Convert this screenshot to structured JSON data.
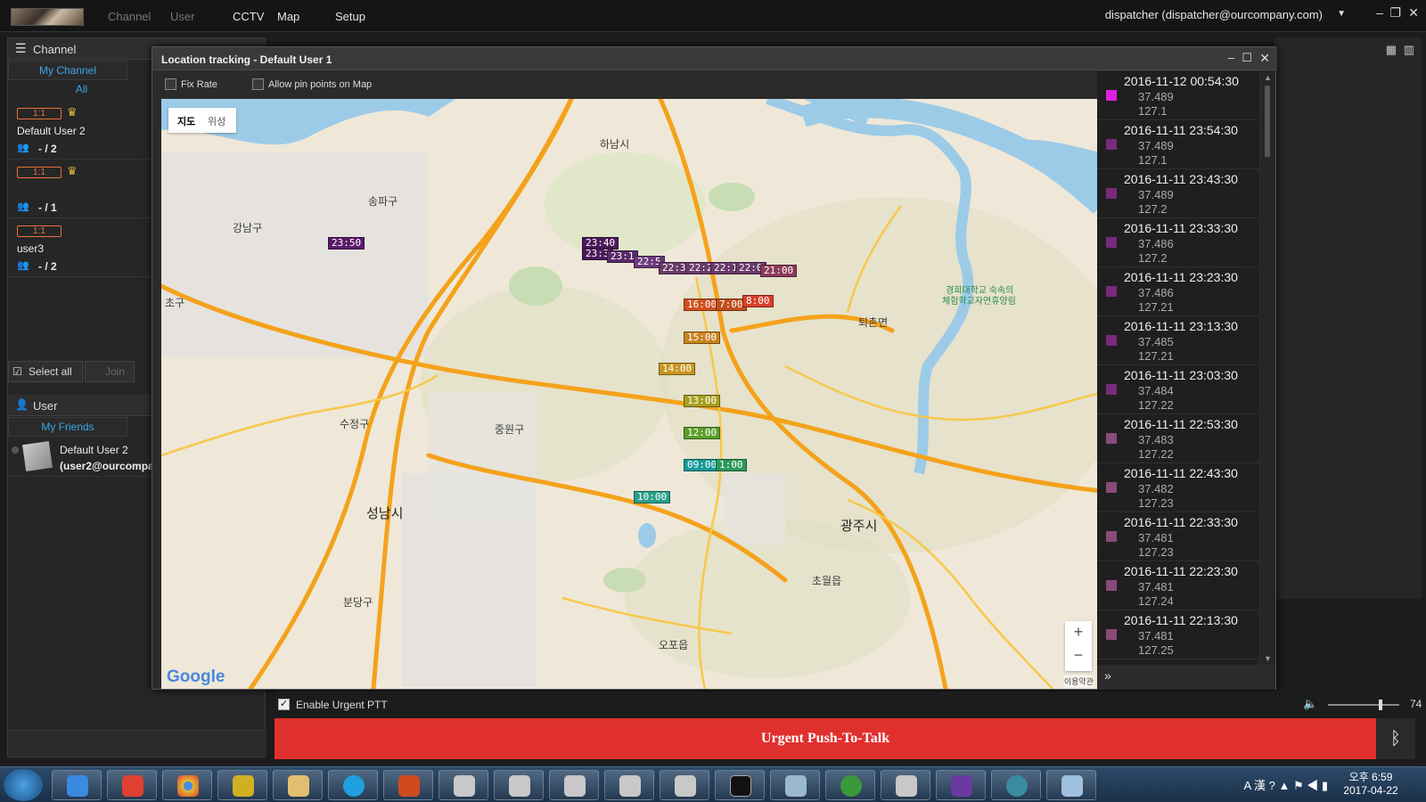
{
  "topbar": {
    "menus": [
      "Channel",
      "User",
      "CCTV",
      "Map",
      "Setup"
    ],
    "user": "dispatcher (dispatcher@ourcompany.com)"
  },
  "left": {
    "channel_header": "Channel",
    "my_channel": "My Channel",
    "all": "All",
    "channels": [
      {
        "badge": "1:1",
        "name": "Default User 2",
        "count": "- / 2"
      },
      {
        "badge": "1:1",
        "name": "",
        "count": "- / 1"
      },
      {
        "badge": "1:1",
        "name": "user3",
        "count": "- / 2"
      }
    ],
    "select_all": "Select all",
    "join": "Join",
    "user_header": "User",
    "my_friends": "My Friends",
    "friend": {
      "name": "Default User 2",
      "email": "(user2@ourcompa"
    }
  },
  "dialog": {
    "title": "Location tracking - Default User 1",
    "fix_rate": "Fix Rate",
    "allow_pin": "Allow pin points on Map",
    "map_tab_map": "지도",
    "map_tab_sat": "위성",
    "zoom_in": "+",
    "zoom_out": "−",
    "google": "Google",
    "terms": "이용약관"
  },
  "map_labels": [
    {
      "t": "하남시"
    },
    {
      "t": "송파구"
    },
    {
      "t": "강남구"
    },
    {
      "t": "초구"
    },
    {
      "t": "수정구"
    },
    {
      "t": "중원구"
    },
    {
      "t": "성남시"
    },
    {
      "t": "분당구"
    },
    {
      "t": "광주시"
    },
    {
      "t": "퇴촌면"
    },
    {
      "t": "초월읍"
    },
    {
      "t": "오포읍"
    },
    {
      "t": "경희대학교 숙속의"
    },
    {
      "t": "체험학교자연휴양림"
    }
  ],
  "markers": [
    {
      "t": "23:50",
      "c": "#5a1a6a"
    },
    {
      "t": "23:40",
      "c": "#4a1a5a"
    },
    {
      "t": "23:3",
      "c": "#4a1a5a"
    },
    {
      "t": "23:1",
      "c": "#5a2a6a"
    },
    {
      "t": "22:5",
      "c": "#6a3a7a"
    },
    {
      "t": "22:3",
      "c": "#6a3a6a"
    },
    {
      "t": "22:2",
      "c": "#6a3a6a"
    },
    {
      "t": "22:1",
      "c": "#6a3a6a"
    },
    {
      "t": "22:0",
      "c": "#6a3a6a"
    },
    {
      "t": "21:00",
      "c": "#8a3a5a"
    },
    {
      "t": "16:00",
      "c": "#d0501e"
    },
    {
      "t": "7:00",
      "c": "#c0501e"
    },
    {
      "t": "8:00",
      "c": "#d8402a"
    },
    {
      "t": "15:00",
      "c": "#c8841e"
    },
    {
      "t": "14:00",
      "c": "#c8961e"
    },
    {
      "t": "13:00",
      "c": "#a8a01e"
    },
    {
      "t": "12:00",
      "c": "#5aa02a"
    },
    {
      "t": "09:00",
      "c": "#1a9a9a"
    },
    {
      "t": "1:00",
      "c": "#2a9a5a"
    },
    {
      "t": "10:00",
      "c": "#2aa08a"
    }
  ],
  "locations": [
    {
      "ts": "2016-11-12 00:54:30",
      "lat": "37.489",
      "lon": "127.1",
      "c": "#e020e0"
    },
    {
      "ts": "2016-11-11 23:54:30",
      "lat": "37.489",
      "lon": "127.1",
      "c": "#7a2a7a"
    },
    {
      "ts": "2016-11-11 23:43:30",
      "lat": "37.489",
      "lon": "127.2",
      "c": "#7a2a7a"
    },
    {
      "ts": "2016-11-11 23:33:30",
      "lat": "37.486",
      "lon": "127.2",
      "c": "#7a2a7a"
    },
    {
      "ts": "2016-11-11 23:23:30",
      "lat": "37.486",
      "lon": "127.21",
      "c": "#7a2a7a"
    },
    {
      "ts": "2016-11-11 23:13:30",
      "lat": "37.485",
      "lon": "127.21",
      "c": "#7a2a7a"
    },
    {
      "ts": "2016-11-11 23:03:30",
      "lat": "37.484",
      "lon": "127.22",
      "c": "#7a2a7a"
    },
    {
      "ts": "2016-11-11 22:53:30",
      "lat": "37.483",
      "lon": "127.22",
      "c": "#8a4a7a"
    },
    {
      "ts": "2016-11-11 22:43:30",
      "lat": "37.482",
      "lon": "127.23",
      "c": "#8a4a7a"
    },
    {
      "ts": "2016-11-11 22:33:30",
      "lat": "37.481",
      "lon": "127.23",
      "c": "#8a4a7a"
    },
    {
      "ts": "2016-11-11 22:23:30",
      "lat": "37.481",
      "lon": "127.24",
      "c": "#8a4a7a"
    },
    {
      "ts": "2016-11-11 22:13:30",
      "lat": "37.481",
      "lon": "127.25",
      "c": "#8a4a7a"
    }
  ],
  "bottom": {
    "enable_urgent": "Enable Urgent PTT",
    "volume": "74",
    "urgent_ptt": "Urgent Push-To-Talk"
  },
  "taskbar": {
    "time": "오후 6:59",
    "date": "2017-04-22"
  }
}
